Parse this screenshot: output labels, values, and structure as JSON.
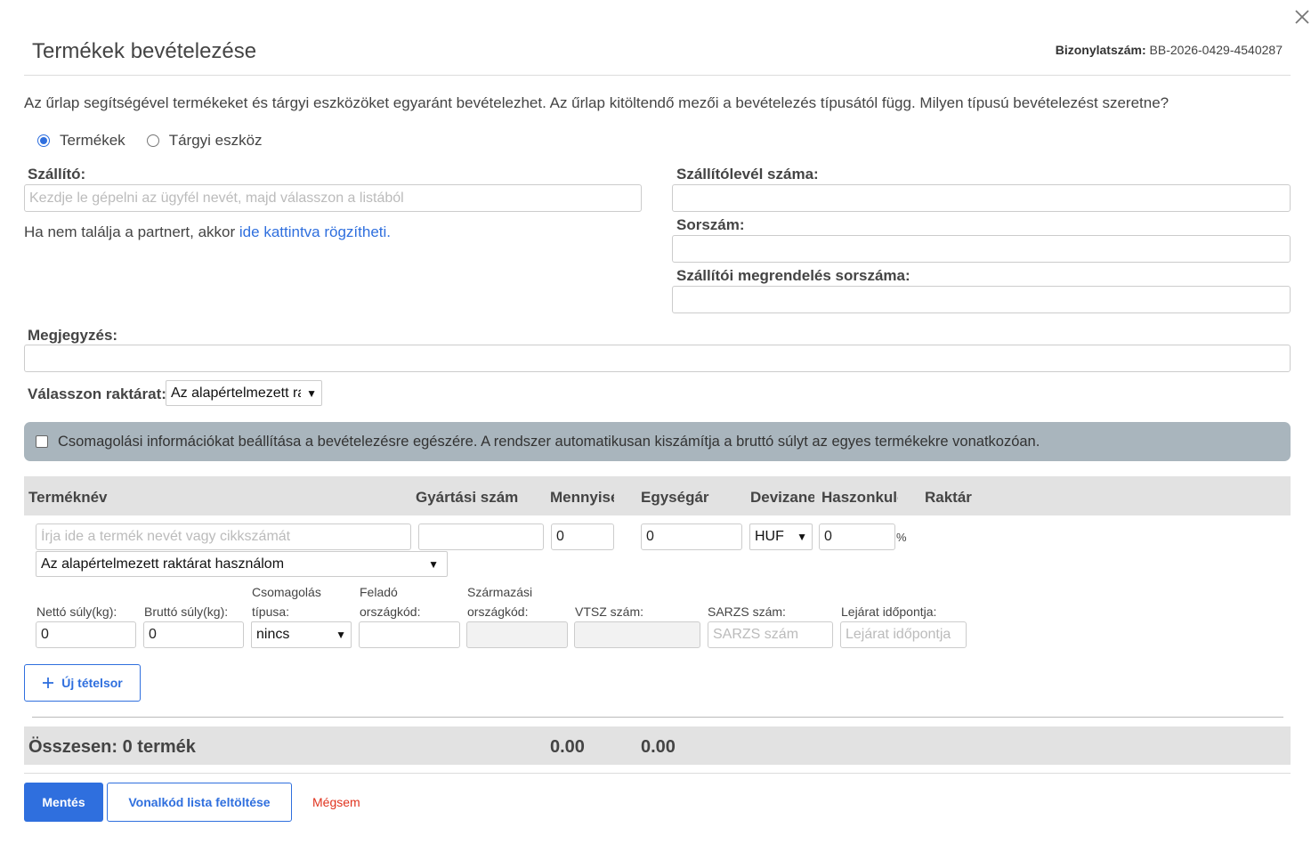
{
  "header": {
    "title": "Termékek bevételezése",
    "doc_label": "Bizonylatszám:",
    "doc_value": "BB-2026-0429-4540287"
  },
  "intro": "Az űrlap segítségével termékeket és tárgyi eszközöket egyaránt bevételezhet. Az űrlap kitöltendő mezői a bevételezés típusától függ. Milyen típusú bevételezést szeretne?",
  "type_options": [
    {
      "label": "Termékek",
      "selected": true
    },
    {
      "label": "Tárgyi eszköz",
      "selected": false
    }
  ],
  "supplier": {
    "label": "Szállító:",
    "placeholder": "Kezdje le gépelni az ügyfél nevét, majd válasszon a listából",
    "hint_prefix": "Ha nem találja a partnert, akkor ",
    "hint_link": "ide kattintva rögzítheti."
  },
  "right_fields": {
    "delivery_note_label": "Szállítólevél száma:",
    "serial_label": "Sorszám:",
    "order_label": "Szállítói megrendelés sorszáma:"
  },
  "note_label": "Megjegyzés:",
  "warehouse": {
    "label": "Válasszon raktárat:",
    "value": "Az alapértelmezett raktár"
  },
  "packaging_text": "Csomagolási információkat beállítása a bevételezésre egészére. A rendszer automatikusan kiszámítja a bruttó súlyt az egyes termékekre vonatkozóan.",
  "table": {
    "headers": {
      "name": "Terméknév",
      "mfg": "Gyártási szám",
      "qty": "Mennyiség",
      "unit_price": "Egységár",
      "currency": "Devizanem",
      "margin": "Haszonkulcs",
      "stock": "Raktár"
    },
    "row": {
      "name_placeholder": "Írja ide a termék nevét vagy cikkszámát",
      "qty": "0",
      "unit_price": "0",
      "currency": "HUF",
      "margin": "0",
      "percent": "%",
      "stock_select": "Az alapértelmezett raktárat használom"
    },
    "details": {
      "net_weight_label": "Nettó súly(kg):",
      "net_weight": "0",
      "gross_weight_label": "Bruttó súly(kg):",
      "gross_weight": "0",
      "pack_type_label_1": "Csomagolás",
      "pack_type_label_2": "típusa:",
      "pack_type": "nincs",
      "sender_label_1": "Feladó",
      "sender_label_2": "országkód:",
      "origin_label_1": "Származási",
      "origin_label_2": "országkód:",
      "vtsz_label": "VTSZ szám:",
      "sarzs_label": "SARZS szám:",
      "sarzs_placeholder": "SARZS szám",
      "expiry_label": "Lejárat időpontja:",
      "expiry_placeholder": "Lejárat időpontja"
    }
  },
  "new_row_button": "Új tételsor",
  "totals": {
    "label": "Összesen: 0 termék",
    "qty": "0.00",
    "amount": "0.00"
  },
  "actions": {
    "save": "Mentés",
    "barcode": "Vonalkód lista feltöltése",
    "cancel": "Mégsem"
  },
  "colors": {
    "primary": "#2f6fde",
    "cancel": "#e0331e",
    "packaging_bg": "#a9b5bd",
    "table_header_bg": "#e2e2e2"
  }
}
